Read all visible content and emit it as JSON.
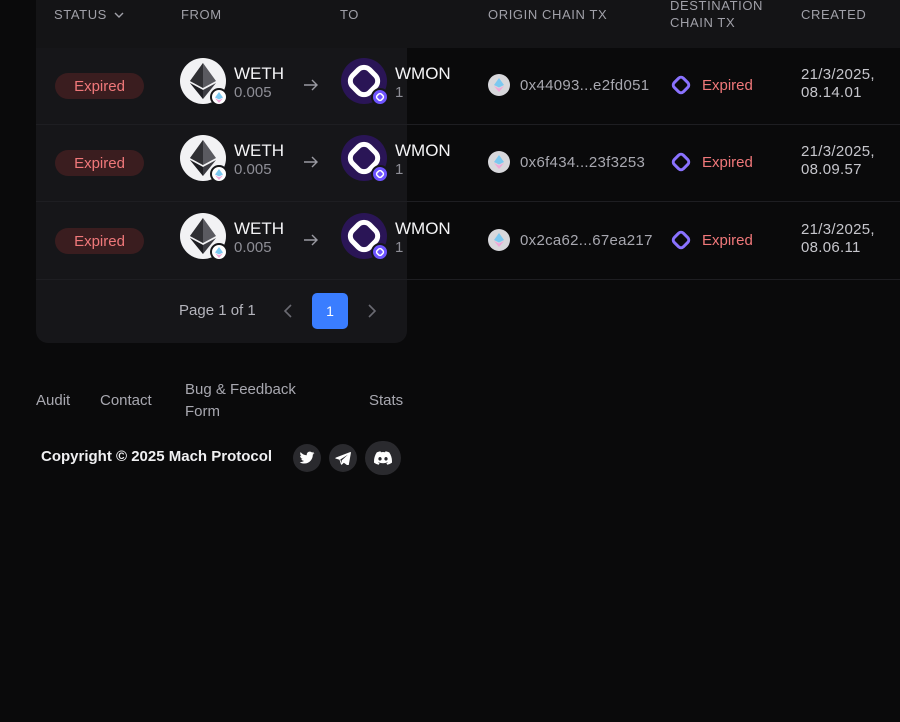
{
  "table": {
    "headers": {
      "status": "STATUS",
      "from": "FROM",
      "to": "TO",
      "origin": "ORIGIN CHAIN TX",
      "destination_line1": "DESTINATION",
      "destination_line2": "CHAIN TX",
      "created": "CREATED"
    },
    "rows": [
      {
        "status": "Expired",
        "from_token": "WETH",
        "from_amount": "0.005",
        "to_token": "WMON",
        "to_amount": "1",
        "origin_tx": "0x44093...e2fd051",
        "destination_tx": "Expired",
        "created_date": "21/3/2025,",
        "created_time": "08.14.01"
      },
      {
        "status": "Expired",
        "from_token": "WETH",
        "from_amount": "0.005",
        "to_token": "WMON",
        "to_amount": "1",
        "origin_tx": "0x6f434...23f3253",
        "destination_tx": "Expired",
        "created_date": "21/3/2025,",
        "created_time": "08.09.57"
      },
      {
        "status": "Expired",
        "from_token": "WETH",
        "from_amount": "0.005",
        "to_token": "WMON",
        "to_amount": "1",
        "origin_tx": "0x2ca62...67ea217",
        "destination_tx": "Expired",
        "created_date": "21/3/2025,",
        "created_time": "08.06.11"
      }
    ]
  },
  "pagination": {
    "label": "Page 1 of 1",
    "current": "1"
  },
  "footer": {
    "links": {
      "audit": "Audit",
      "contact": "Contact",
      "bug": "Bug & Feedback Form",
      "stats": "Stats"
    },
    "copyright": "Copyright © 2025 Mach Protocol"
  },
  "icons": {
    "social": [
      "twitter-icon",
      "telegram-icon",
      "discord-icon"
    ],
    "eth": "ethereum-icon",
    "mon": "monad-icon"
  },
  "colors": {
    "expired_text": "#f0787a",
    "expired_bg": "#3a1d1f",
    "accent_blue": "#3a7dff",
    "monad_purple": "#6e54ff"
  }
}
